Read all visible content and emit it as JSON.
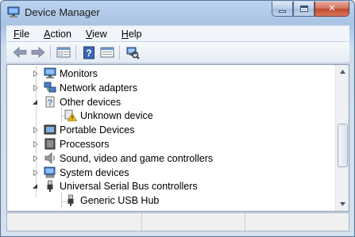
{
  "window": {
    "title": "Device Manager"
  },
  "menu": [
    {
      "accel": "F",
      "rest": "ile"
    },
    {
      "accel": "A",
      "rest": "ction"
    },
    {
      "accel": "V",
      "rest": "iew"
    },
    {
      "accel": "H",
      "rest": "elp"
    }
  ],
  "toolbar": {
    "buttons": [
      "back-arrow-icon",
      "forward-arrow-icon",
      "properties-icon",
      "help-icon",
      "show-hide-pane-icon",
      "scan-hardware-icon"
    ]
  },
  "tree": {
    "monitors": "Monitors",
    "network_adapters": "Network adapters",
    "other_devices": "Other devices",
    "unknown_device": "Unknown device",
    "portable_devices": "Portable Devices",
    "processors": "Processors",
    "sound": "Sound, video and game controllers",
    "system_devices": "System devices",
    "usb_controllers": "Universal Serial Bus controllers",
    "generic_usb_hub": "Generic USB Hub"
  },
  "colors": {
    "accent": "#2a5ea8",
    "close_button": "#c0472c",
    "warning": "#f2c21b"
  }
}
